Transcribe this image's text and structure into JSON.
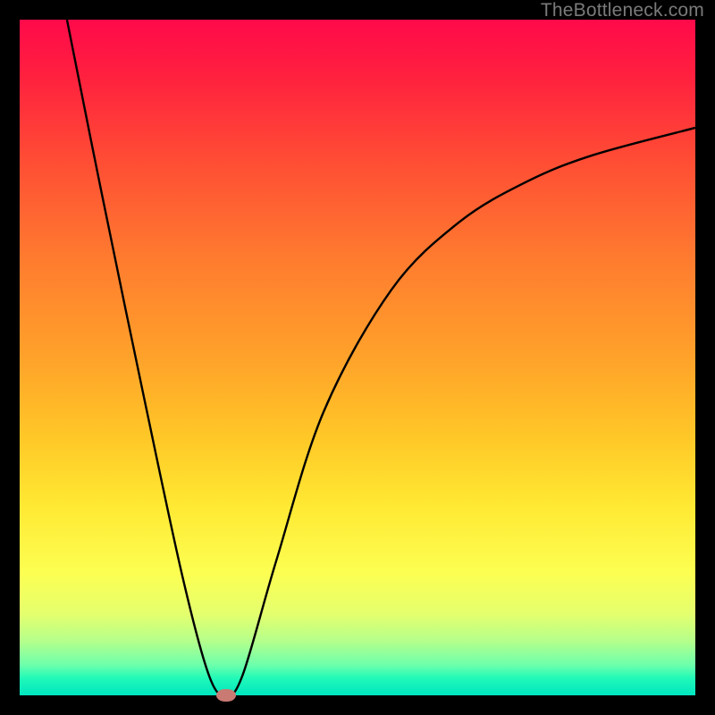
{
  "watermark": "TheBottleneck.com",
  "colors": {
    "frame": "#000000",
    "curve": "#000000",
    "marker": "#c97a72"
  },
  "chart_data": {
    "type": "line",
    "title": "",
    "xlabel": "",
    "ylabel": "",
    "xlim": [
      0,
      100
    ],
    "ylim": [
      0,
      100
    ],
    "grid": false,
    "series": [
      {
        "name": "bottleneck-curve",
        "x": [
          7,
          12,
          18,
          24,
          28,
          30.5,
          33,
          38,
          45,
          55,
          65,
          75,
          85,
          100
        ],
        "y": [
          100,
          75,
          46,
          18,
          3,
          0,
          3,
          20,
          42,
          60,
          70,
          76,
          80,
          84
        ]
      }
    ],
    "annotations": [
      {
        "name": "optimal-marker",
        "x": 30.5,
        "y": 0
      }
    ]
  }
}
